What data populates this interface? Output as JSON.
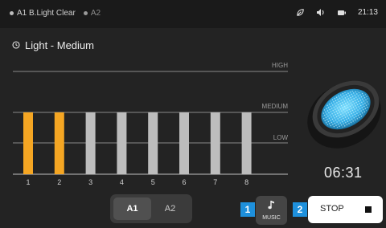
{
  "status": {
    "tags": [
      {
        "label": "A1 B.Light Clear",
        "active": true
      },
      {
        "label": "A2",
        "active": false
      }
    ],
    "time": "21:13",
    "icons": [
      "leaf-icon",
      "volume-icon",
      "battery-icon"
    ]
  },
  "mode_label": "Light - Medium",
  "chart_data": {
    "type": "bar",
    "categories": [
      "1",
      "2",
      "3",
      "4",
      "5",
      "6",
      "7",
      "8"
    ],
    "levels": [
      "LOW",
      "MEDIUM",
      "HIGH"
    ],
    "values": [
      2,
      2,
      2,
      2,
      2,
      2,
      2,
      2
    ],
    "active": [
      true,
      true,
      false,
      false,
      false,
      false,
      false,
      false
    ],
    "colors": {
      "active": "#f5a623",
      "inactive": "#bdbdbd"
    }
  },
  "timer": "06:31",
  "zone_toggle": {
    "options": [
      "A1",
      "A2"
    ],
    "selected": "A1"
  },
  "callouts": [
    "1",
    "2"
  ],
  "music_button": {
    "label": "MUSIC"
  },
  "stop_button": {
    "label": "STOP"
  },
  "colors": {
    "accent": "#1e90dc",
    "bar_active": "#f5a623",
    "lamp_glow": "#3ab8ee"
  }
}
